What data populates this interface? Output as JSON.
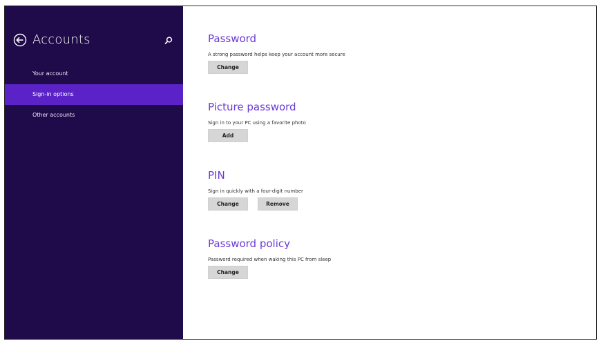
{
  "sidebar": {
    "title": "Accounts",
    "back_icon": "back-arrow-circle-icon",
    "search_icon": "search-icon",
    "items": [
      {
        "label": "Your account",
        "active": false
      },
      {
        "label": "Sign-in options",
        "active": true
      },
      {
        "label": "Other accounts",
        "active": false
      }
    ]
  },
  "main": {
    "sections": [
      {
        "title": "Password",
        "description": "A strong password helps keep your account more secure",
        "buttons": [
          "Change"
        ]
      },
      {
        "title": "Picture password",
        "description": "Sign in to your PC using a favorite photo",
        "buttons": [
          "Add"
        ]
      },
      {
        "title": "PIN",
        "description": "Sign in quickly with a four-digit number",
        "buttons": [
          "Change",
          "Remove"
        ]
      },
      {
        "title": "Password policy",
        "description": "Password required when waking this PC from sleep",
        "buttons": [
          "Change"
        ]
      }
    ]
  },
  "colors": {
    "sidebar_bg": "#1f0b4a",
    "sidebar_active": "#5a22c7",
    "accent_title": "#6a39d6",
    "button_bg": "#d6d6d6"
  }
}
